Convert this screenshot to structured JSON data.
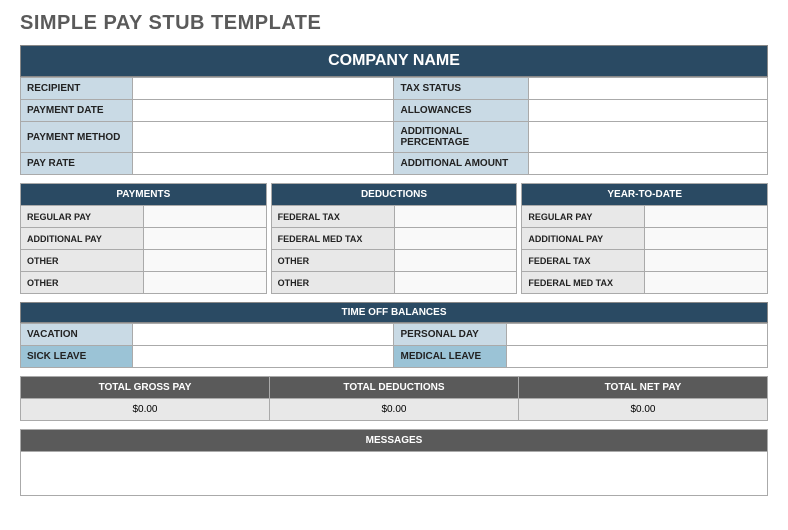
{
  "page_title": "SIMPLE PAY STUB TEMPLATE",
  "company_header": "COMPANY NAME",
  "info_left": [
    {
      "label": "RECIPIENT",
      "value": ""
    },
    {
      "label": "PAYMENT DATE",
      "value": ""
    },
    {
      "label": "PAYMENT METHOD",
      "value": ""
    },
    {
      "label": "PAY RATE",
      "value": ""
    }
  ],
  "info_right": [
    {
      "label": "TAX STATUS",
      "value": ""
    },
    {
      "label": "ALLOWANCES",
      "value": ""
    },
    {
      "label": "ADDITIONAL PERCENTAGE",
      "value": ""
    },
    {
      "label": "ADDITIONAL AMOUNT",
      "value": ""
    }
  ],
  "columns": {
    "payments": {
      "header": "PAYMENTS",
      "rows": [
        "REGULAR PAY",
        "ADDITIONAL PAY",
        "OTHER",
        "OTHER"
      ]
    },
    "deductions": {
      "header": "DEDUCTIONS",
      "rows": [
        "FEDERAL TAX",
        "FEDERAL MED TAX",
        "OTHER",
        "OTHER"
      ]
    },
    "ytd": {
      "header": "YEAR-TO-DATE",
      "rows": [
        "REGULAR PAY",
        "ADDITIONAL PAY",
        "FEDERAL TAX",
        "FEDERAL MED TAX"
      ]
    }
  },
  "time_off": {
    "header": "TIME OFF BALANCES",
    "left": [
      "VACATION",
      "SICK LEAVE"
    ],
    "right": [
      "PERSONAL DAY",
      "MEDICAL LEAVE"
    ]
  },
  "totals": {
    "gross": {
      "label": "TOTAL GROSS PAY",
      "value": "$0.00"
    },
    "deductions": {
      "label": "TOTAL DEDUCTIONS",
      "value": "$0.00"
    },
    "net": {
      "label": "TOTAL NET PAY",
      "value": "$0.00"
    }
  },
  "messages": {
    "header": "MESSAGES",
    "body": ""
  }
}
